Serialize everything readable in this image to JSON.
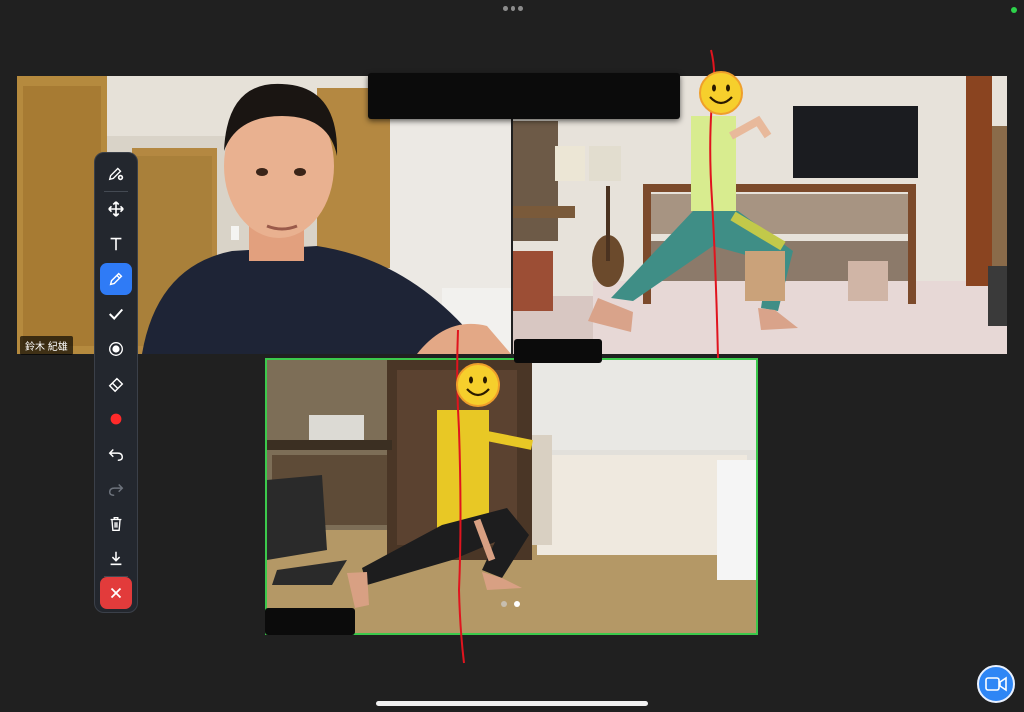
{
  "participants": {
    "self_name": "鈴木 紀雄"
  },
  "toolbar": {
    "tools": [
      {
        "name": "pen-settings",
        "icon": "pen-gear-icon"
      },
      {
        "name": "move",
        "icon": "move-arrows-icon"
      },
      {
        "name": "text",
        "icon": "text-icon",
        "glyph": "T"
      },
      {
        "name": "pencil",
        "icon": "pencil-icon",
        "active": true
      },
      {
        "name": "stamp",
        "icon": "checkmark-icon"
      },
      {
        "name": "spotlight",
        "icon": "spotlight-icon"
      },
      {
        "name": "eraser",
        "icon": "eraser-icon"
      },
      {
        "name": "color",
        "icon": "color-dot-icon",
        "color": "#ff2a2a"
      },
      {
        "name": "undo",
        "icon": "undo-icon"
      },
      {
        "name": "redo",
        "icon": "redo-icon"
      },
      {
        "name": "clear",
        "icon": "trash-icon"
      },
      {
        "name": "save",
        "icon": "download-icon"
      },
      {
        "name": "close",
        "icon": "close-x-icon"
      }
    ]
  },
  "colors": {
    "accent": "#2f7bf6",
    "active_speaker_border": "#3cc94c",
    "annotation": "#e0141e",
    "close": "#e23b3b"
  },
  "pagination": {
    "pages": 2,
    "current": 2
  }
}
